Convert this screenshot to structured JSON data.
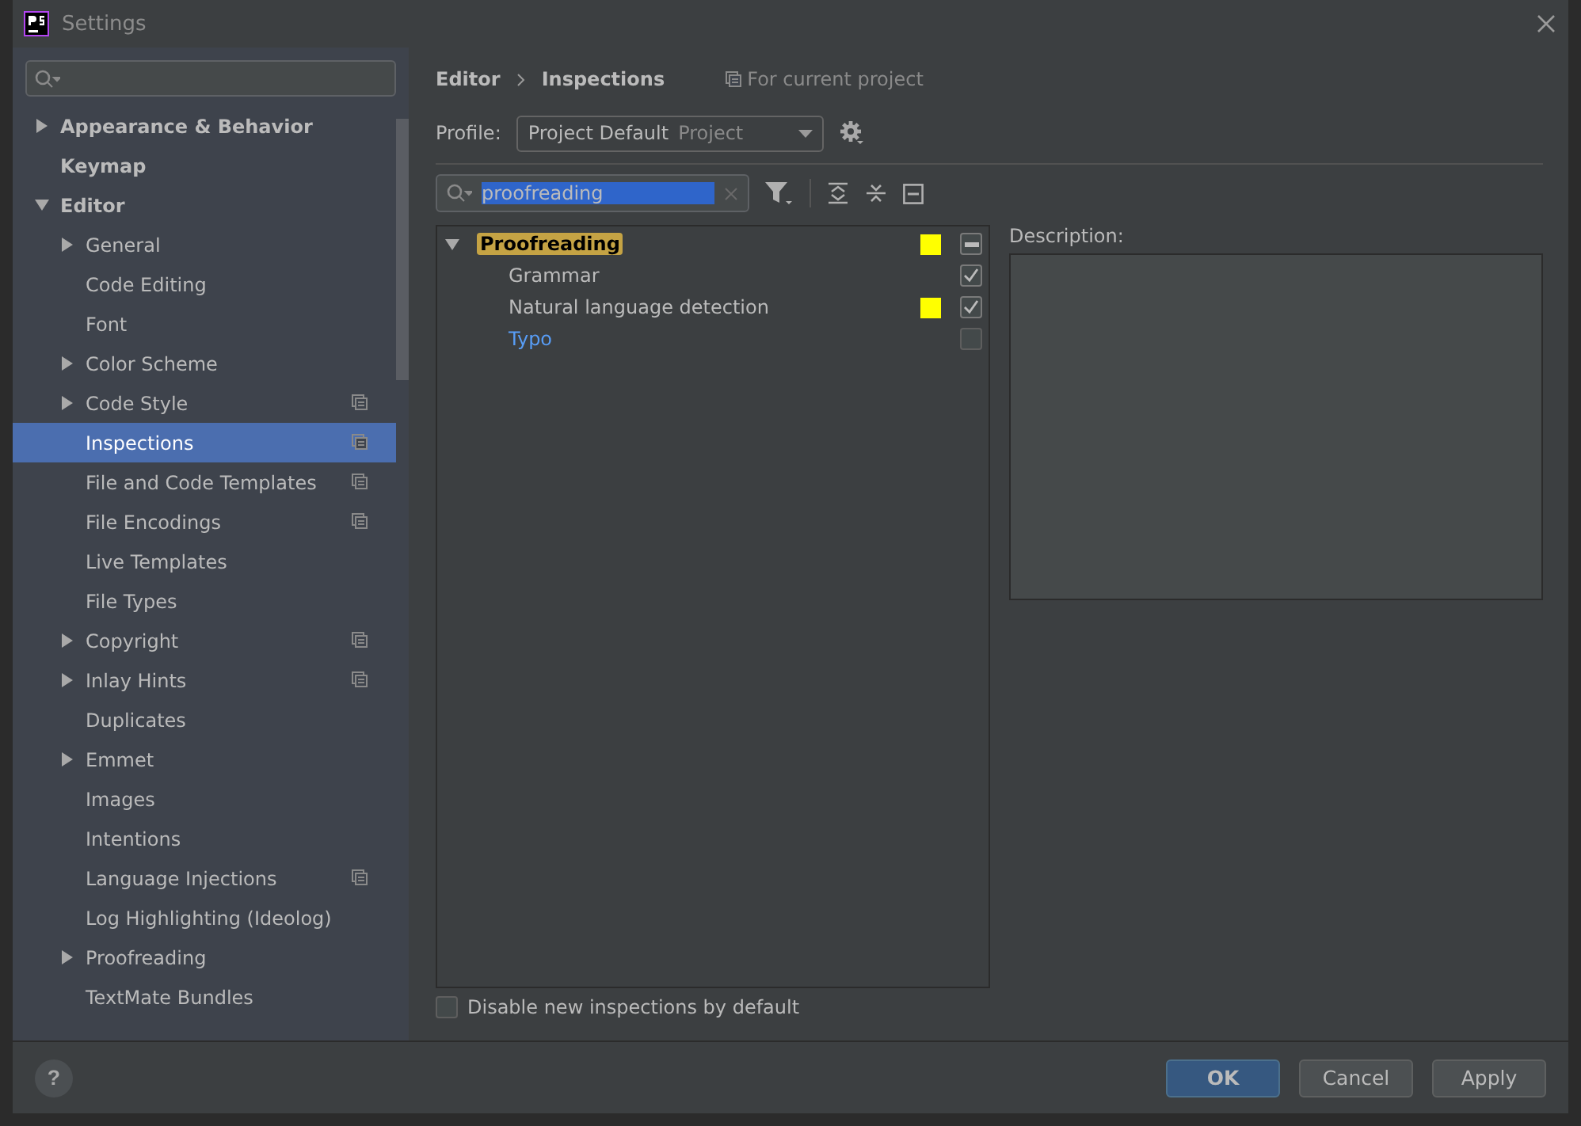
{
  "window": {
    "title": "Settings"
  },
  "sidebar": {
    "items": [
      {
        "label": "Appearance & Behavior",
        "expanded": false,
        "expandable": true,
        "selected": false,
        "project_scope": false
      },
      {
        "label": "Keymap",
        "expandable": false,
        "selected": false,
        "project_scope": false
      },
      {
        "label": "Editor",
        "expanded": true,
        "expandable": true,
        "selected": false,
        "project_scope": false,
        "children": [
          {
            "label": "General",
            "expandable": true,
            "expanded": false,
            "selected": false,
            "project_scope": false
          },
          {
            "label": "Code Editing",
            "expandable": false,
            "selected": false,
            "project_scope": false
          },
          {
            "label": "Font",
            "expandable": false,
            "selected": false,
            "project_scope": false
          },
          {
            "label": "Color Scheme",
            "expandable": true,
            "expanded": false,
            "selected": false,
            "project_scope": false
          },
          {
            "label": "Code Style",
            "expandable": true,
            "expanded": false,
            "selected": false,
            "project_scope": true
          },
          {
            "label": "Inspections",
            "expandable": false,
            "selected": true,
            "project_scope": true
          },
          {
            "label": "File and Code Templates",
            "expandable": false,
            "selected": false,
            "project_scope": true
          },
          {
            "label": "File Encodings",
            "expandable": false,
            "selected": false,
            "project_scope": true
          },
          {
            "label": "Live Templates",
            "expandable": false,
            "selected": false,
            "project_scope": false
          },
          {
            "label": "File Types",
            "expandable": false,
            "selected": false,
            "project_scope": false
          },
          {
            "label": "Copyright",
            "expandable": true,
            "expanded": false,
            "selected": false,
            "project_scope": true
          },
          {
            "label": "Inlay Hints",
            "expandable": true,
            "expanded": false,
            "selected": false,
            "project_scope": true
          },
          {
            "label": "Duplicates",
            "expandable": false,
            "selected": false,
            "project_scope": false
          },
          {
            "label": "Emmet",
            "expandable": true,
            "expanded": false,
            "selected": false,
            "project_scope": false
          },
          {
            "label": "Images",
            "expandable": false,
            "selected": false,
            "project_scope": false
          },
          {
            "label": "Intentions",
            "expandable": false,
            "selected": false,
            "project_scope": false
          },
          {
            "label": "Language Injections",
            "expandable": false,
            "selected": false,
            "project_scope": true
          },
          {
            "label": "Log Highlighting (Ideolog)",
            "expandable": false,
            "selected": false,
            "project_scope": false
          },
          {
            "label": "Proofreading",
            "expandable": true,
            "expanded": false,
            "selected": false,
            "project_scope": false
          },
          {
            "label": "TextMate Bundles",
            "expandable": false,
            "selected": false,
            "project_scope": false
          }
        ]
      }
    ]
  },
  "breadcrumb": [
    "Editor",
    "Inspections"
  ],
  "scope_note": "For current project",
  "profile": {
    "label": "Profile:",
    "value": "Project Default",
    "scope": "Project"
  },
  "filter": {
    "value": "proofreading"
  },
  "inspections": [
    {
      "label": "Proofreading",
      "match": true,
      "expanded": true,
      "modified": false,
      "color": "#ffff00",
      "checked": true,
      "partial": true,
      "children": [
        {
          "label": "Grammar",
          "match": false,
          "modified": false,
          "checked": true,
          "partial": false
        },
        {
          "label": "Natural language detection",
          "match": false,
          "modified": false,
          "color": "#ffff00",
          "checked": true,
          "partial": false
        },
        {
          "label": "Typo",
          "match": false,
          "modified": true,
          "checked": false,
          "partial": false
        }
      ]
    }
  ],
  "description": {
    "label": "Description:"
  },
  "disable_new": {
    "label": "Disable new inspections by default",
    "checked": false
  },
  "help_button": {
    "label": "?"
  },
  "buttons": [
    {
      "label": "OK",
      "primary": true
    },
    {
      "label": "Cancel",
      "primary": false
    },
    {
      "label": "Apply",
      "primary": false
    }
  ]
}
